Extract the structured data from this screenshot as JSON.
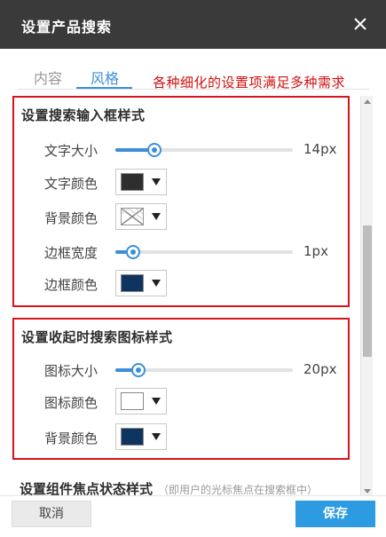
{
  "dialog": {
    "title": "设置产品搜索"
  },
  "tabs": [
    {
      "label": "内容",
      "active": false
    },
    {
      "label": "风格",
      "active": true
    }
  ],
  "annotation": "各种细化的设置项满足多种需求",
  "input_style": {
    "title": "设置搜索输入框样式",
    "font_size": {
      "label": "文字大小",
      "value": "14px",
      "fraction": 0.22
    },
    "font_color": {
      "label": "文字颜色",
      "color": "#2e2e2e"
    },
    "bg_color": {
      "label": "背景颜色",
      "color": "none"
    },
    "border_width": {
      "label": "边框宽度",
      "value": "1px",
      "fraction": 0.1
    },
    "border_color": {
      "label": "边框颜色",
      "color": "#0d3560"
    }
  },
  "icon_style": {
    "title": "设置收起时搜索图标样式",
    "icon_size": {
      "label": "图标大小",
      "value": "20px",
      "fraction": 0.13
    },
    "icon_color": {
      "label": "图标颜色",
      "color": "#ffffff"
    },
    "bg_color": {
      "label": "背景颜色",
      "color": "#0d3560"
    }
  },
  "focus_style": {
    "title": "设置组件焦点状态样式",
    "note": "（即用户的光标焦点在搜索框中）"
  },
  "footer": {
    "cancel_label": "取消",
    "save_label": "保存"
  },
  "colors": {
    "accent": "#3c8fd7",
    "highlight": "#d9131b",
    "titlebar": "#3a3a3a",
    "save": "#2d9be1"
  }
}
